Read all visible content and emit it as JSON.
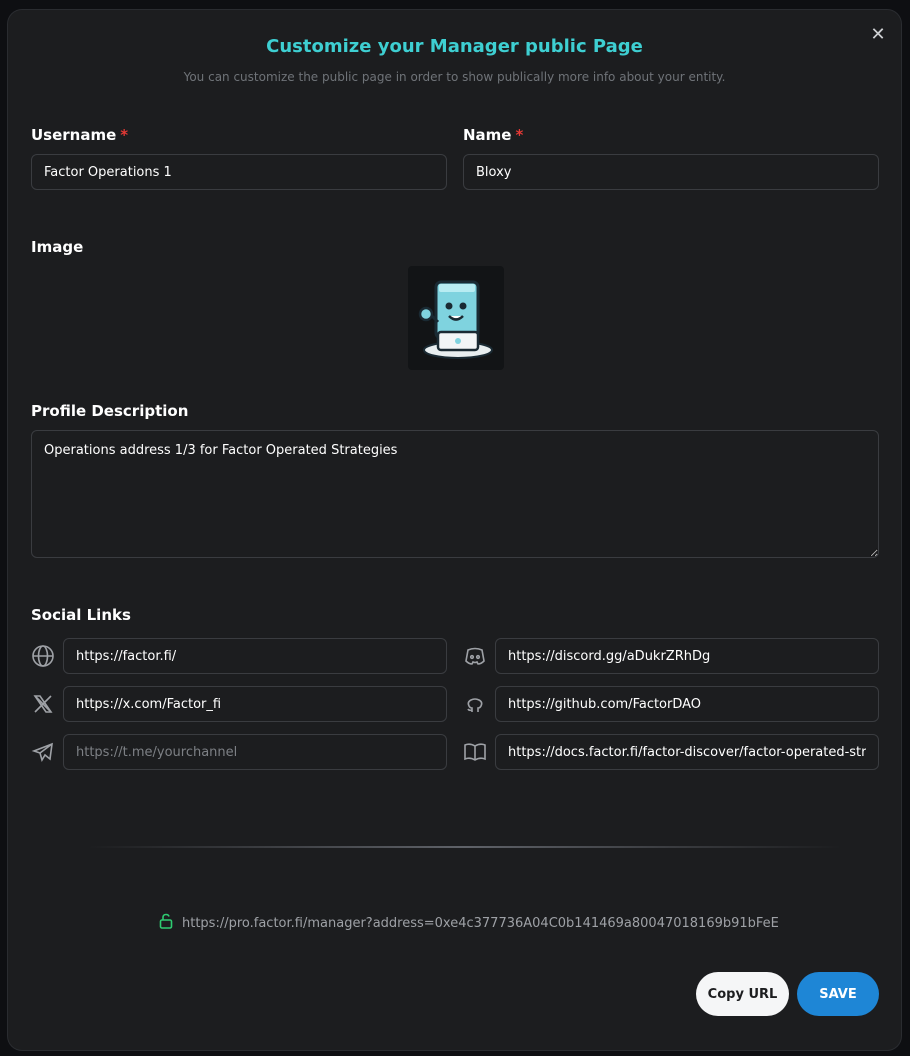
{
  "modal": {
    "title": "Customize your Manager public Page",
    "subtitle": "You can customize the public page in order to show publically more info about your entity.",
    "close_icon": "close-icon"
  },
  "form": {
    "username": {
      "label": "Username",
      "required_mark": "*",
      "value": "Factor Operations 1"
    },
    "name": {
      "label": "Name",
      "required_mark": "*",
      "value": "Bloxy"
    },
    "image": {
      "label": "Image"
    },
    "description": {
      "label": "Profile Description",
      "value": "Operations address 1/3 for Factor Operated Strategies"
    },
    "social": {
      "label": "Social Links",
      "website": {
        "icon": "globe-icon",
        "value": "https://factor.fi/"
      },
      "discord": {
        "icon": "discord-icon",
        "value": "https://discord.gg/aDukrZRhDg"
      },
      "x": {
        "icon": "x-icon",
        "value": "https://x.com/Factor_fi"
      },
      "github": {
        "icon": "github-icon",
        "value": "https://github.com/FactorDAO"
      },
      "telegram": {
        "icon": "telegram-icon",
        "value": "",
        "placeholder": "https://t.me/yourchannel"
      },
      "docs": {
        "icon": "book-icon",
        "value": "https://docs.factor.fi/factor-discover/factor-operated-str"
      }
    }
  },
  "public_url": {
    "icon": "unlock-icon",
    "text": "https://pro.factor.fi/manager?address=0xe4c377736A04C0b141469a80047018169b91bFeE"
  },
  "buttons": {
    "copy_url": "Copy URL",
    "save": "SAVE"
  },
  "colors": {
    "accent": "#3ecfd2",
    "primary_button": "#1e86d6",
    "required": "#e53935",
    "lock": "#2ecc71"
  }
}
